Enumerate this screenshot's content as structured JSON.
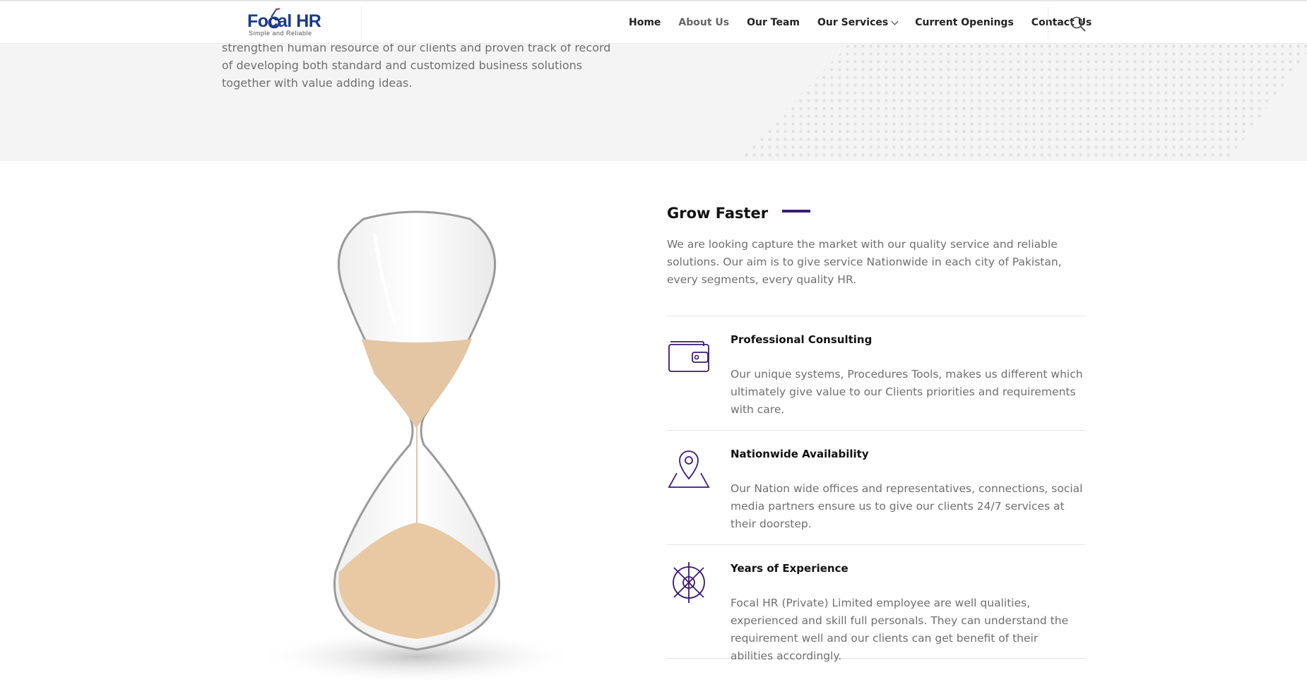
{
  "logo": {
    "title": "Focal HR",
    "tagline": "Simple and Reliable"
  },
  "nav": {
    "items": [
      {
        "label": "Home"
      },
      {
        "label": "About Us"
      },
      {
        "label": "Our Services"
      },
      {
        "label": "Our Team"
      },
      {
        "label": "Current Openings"
      },
      {
        "label": "Contact Us"
      }
    ]
  },
  "hero": {
    "text": "strengthen human resource of our clients and proven track of record of developing both standard and customized business solutions together with value adding ideas."
  },
  "section": {
    "heading": "Grow Faster",
    "intro": "We are looking capture the market with our quality service and reliable solutions. Our aim is to give service Nationwide in each city of Pakistan, every segments, every quality HR."
  },
  "features": [
    {
      "icon": "wallet-icon",
      "title": "Professional Consulting",
      "desc": "Our unique systems, Procedures Tools, makes us different which ultimately give value to our Clients priorities and requirements with care."
    },
    {
      "icon": "map-pin-icon",
      "title": "Nationwide Availability",
      "desc": "Our Nation wide offices and representatives, connections, social media partners ensure us to give our clients 24/7 services at their doorstep."
    },
    {
      "icon": "target-icon",
      "title": "Years of Experience",
      "desc": "Focal HR (Private) Limited employee are well qualities, experienced and skill full personals. They can understand the requirement well and our clients can get benefit of their abilities accordingly."
    }
  ],
  "colors": {
    "accent": "#3b1a7a",
    "brand": "#1a3a8c",
    "text_muted": "#6f6f6f"
  }
}
